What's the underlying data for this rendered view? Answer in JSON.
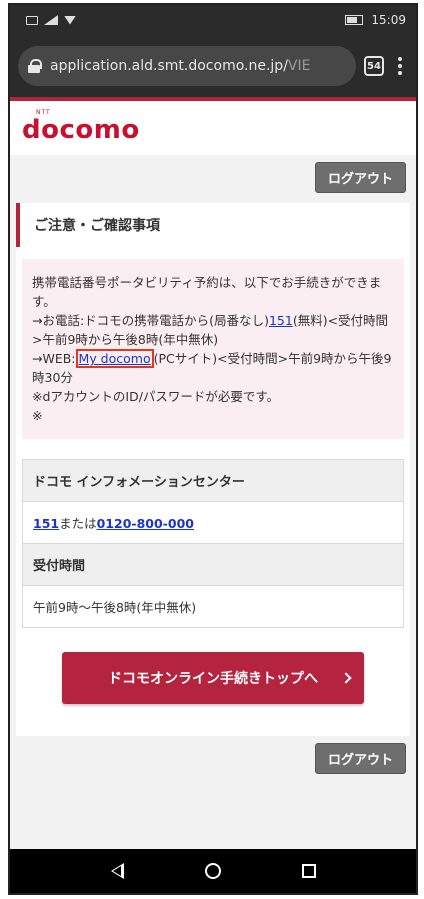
{
  "status_bar": {
    "time": "15:09",
    "battery_label": ""
  },
  "browser": {
    "url_main": "application.ald.smt.docomo.ne.jp/",
    "url_fade": "VIE",
    "tab_count": "54"
  },
  "header": {
    "logo_small": "NTT",
    "logo": "docomo"
  },
  "logout_label": "ログアウト",
  "section": {
    "title": "ご注意・ご確認事項"
  },
  "notice": {
    "line1": "携帯電話番号ポータビリティ予約は、以下でお手続きができます。",
    "line2_prefix": "→お電話:ドコモの携帯電話から(局番なし)",
    "line2_link": "151",
    "line2_suffix": "(無料)<受付時間>午前9時から午後8時(年中無休)",
    "line3_prefix": "→WEB:",
    "line3_link": "My docomo",
    "line3_suffix": "(PCサイト)<受付時間>午前9時から午後9時30分",
    "line4": "※dアカウントのID/パスワードが必要です。",
    "line5": "※"
  },
  "info": {
    "center_heading": "ドコモ インフォメーションセンター",
    "phone1": "151",
    "phone_sep": "または",
    "phone2": "0120-800-000",
    "hours_heading": "受付時間",
    "hours_value": "午前9時〜午後8時(年中無休)"
  },
  "cta": {
    "label": "ドコモオンライン手続きトップへ"
  },
  "colors": {
    "brand": "#c8102e",
    "cta": "#b5243f",
    "link": "#1a35c9",
    "highlight_border": "#e03a1e"
  }
}
